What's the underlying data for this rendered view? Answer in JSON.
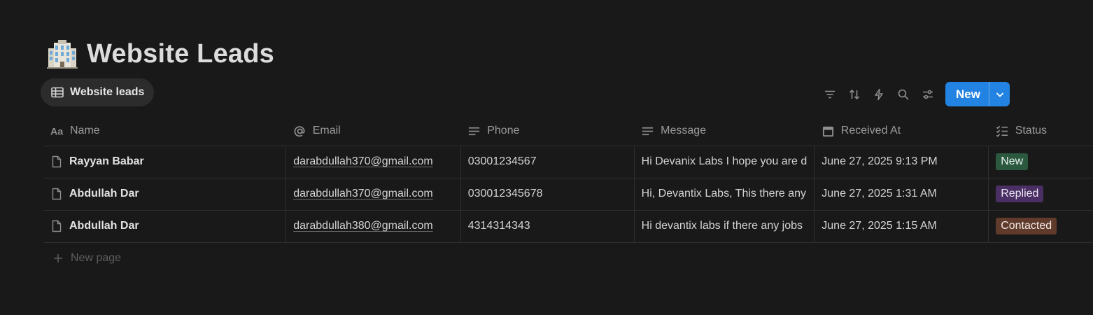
{
  "page": {
    "title": "Website Leads",
    "icon": "office-building-icon"
  },
  "view_tab": {
    "label": "Website leads",
    "icon": "table-icon"
  },
  "toolbar": {
    "icons": [
      "filter-icon",
      "sort-icon",
      "automation-lightning-icon",
      "search-icon",
      "view-settings-icon"
    ],
    "new_label": "New"
  },
  "columns": [
    {
      "label": "Name",
      "icon": "title-text-icon"
    },
    {
      "label": "Email",
      "icon": "at-sign-icon"
    },
    {
      "label": "Phone",
      "icon": "text-lines-icon"
    },
    {
      "label": "Message",
      "icon": "text-lines-icon"
    },
    {
      "label": "Received At",
      "icon": "calendar-icon"
    },
    {
      "label": "Status",
      "icon": "checklist-icon"
    }
  ],
  "rows": [
    {
      "name": "Rayyan Babar",
      "email": "darabdullah370@gmail.com",
      "phone": "03001234567",
      "message": "Hi Devanix Labs I hope you are d",
      "received_at": "June 27, 2025 9:13 PM",
      "status": "New"
    },
    {
      "name": "Abdullah Dar",
      "email": "darabdullah370@gmail.com",
      "phone": "030012345678",
      "message": "Hi, Devantix Labs, This there any",
      "received_at": "June 27, 2025 1:31 AM",
      "status": "Replied"
    },
    {
      "name": "Abdullah Dar",
      "email": "darabdullah380@gmail.com",
      "phone": "4314314343",
      "message": "Hi devantix labs if there any jobs",
      "received_at": "June 27, 2025 1:15 AM",
      "status": "Contacted"
    }
  ],
  "status_colors": {
    "New": {
      "bg": "#2b593f",
      "fg": "#e8f1ec"
    },
    "Replied": {
      "bg": "#492f64",
      "fg": "#ece6f3"
    },
    "Contacted": {
      "bg": "#603b2c",
      "fg": "#f3e9e4"
    }
  },
  "new_page_label": "New page",
  "accent_color": "#2383e2"
}
